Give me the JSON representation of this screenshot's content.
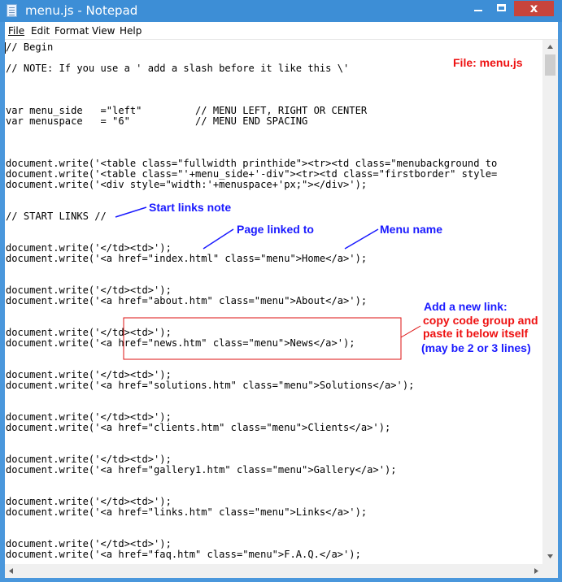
{
  "window": {
    "title": "menu.js - Notepad",
    "controls": {
      "minimize": "minimize",
      "maximize": "maximize",
      "close": "x"
    }
  },
  "menubar": {
    "file": "File",
    "edit": "Edit",
    "format": "Format",
    "view": "View",
    "help": "Help"
  },
  "code_lines": [
    "// Begin",
    "",
    "// NOTE: If you use a ' add a slash before it like this \\'",
    "",
    "",
    "",
    "var menu_side   =\"left\"         // MENU LEFT, RIGHT OR CENTER",
    "var menuspace   = \"6\"           // MENU END SPACING",
    "",
    "",
    "",
    "document.write('<table class=\"fullwidth printhide\"><tr><td class=\"menubackground to",
    "document.write('<table class=\"'+menu_side+'-div\"><tr><td class=\"firstborder\" style=",
    "document.write('<div style=\"width:'+menuspace+'px;\"></div>');",
    "",
    "",
    "// START LINKS //",
    "",
    "",
    "document.write('</td><td>');",
    "document.write('<a href=\"index.html\" class=\"menu\">Home</a>');",
    "",
    "",
    "document.write('</td><td>');",
    "document.write('<a href=\"about.htm\" class=\"menu\">About</a>');",
    "",
    "",
    "document.write('</td><td>');",
    "document.write('<a href=\"news.htm\" class=\"menu\">News</a>');",
    "",
    "",
    "document.write('</td><td>');",
    "document.write('<a href=\"solutions.htm\" class=\"menu\">Solutions</a>');",
    "",
    "",
    "document.write('</td><td>');",
    "document.write('<a href=\"clients.htm\" class=\"menu\">Clients</a>');",
    "",
    "",
    "document.write('</td><td>');",
    "document.write('<a href=\"gallery1.htm\" class=\"menu\">Gallery</a>');",
    "",
    "",
    "document.write('</td><td>');",
    "document.write('<a href=\"links.htm\" class=\"menu\">Links</a>');",
    "",
    "",
    "document.write('</td><td>');",
    "document.write('<a href=\"faq.htm\" class=\"menu\">F.A.Q.</a>');"
  ],
  "annotations": {
    "file_label": "File: menu.js",
    "start_links_note": "Start links note",
    "page_linked_to": "Page linked to",
    "menu_name": "Menu name",
    "add_link_1": "Add a new link:",
    "add_link_2": "copy code group and",
    "add_link_3": "paste it below itself",
    "add_link_4": "(may be 2 or 3 lines)"
  },
  "colors": {
    "titlebar": "#3d8ed6",
    "close": "#c7443c",
    "annotation_blue": "#1a1aff",
    "annotation_red": "#ee1111"
  }
}
